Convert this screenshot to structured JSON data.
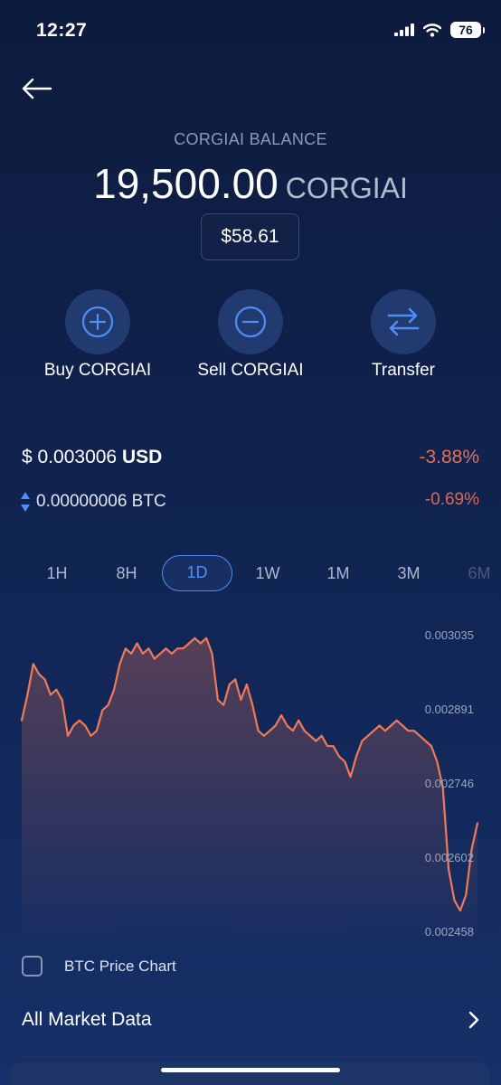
{
  "status_bar": {
    "time": "12:27",
    "battery": "76"
  },
  "header": {
    "balance_label": "CORGIAI BALANCE",
    "balance_amount": "19,500.00",
    "balance_unit": "CORGIAI",
    "usd_value": "$58.61"
  },
  "actions": [
    {
      "label": "Buy CORGIAI",
      "icon": "plus-circle-icon"
    },
    {
      "label": "Sell CORGIAI",
      "icon": "minus-circle-icon"
    },
    {
      "label": "Transfer",
      "icon": "swap-arrows-icon"
    }
  ],
  "price": {
    "usd_prefix": "$ ",
    "usd_value": "0.003006",
    "usd_suffix": " USD",
    "usd_change": "-3.88%",
    "btc_value": "0.00000006 BTC",
    "btc_change": "-0.69%"
  },
  "ranges": {
    "items": [
      "1H",
      "8H",
      "1D",
      "1W",
      "1M",
      "3M",
      "6M"
    ],
    "selected": "1D"
  },
  "chart_data": {
    "type": "area",
    "ylim": [
      0.002458,
      0.003035
    ],
    "y_ticks": [
      "0.003035",
      "0.002891",
      "0.002746",
      "0.002602",
      "0.002458"
    ],
    "x": [
      0,
      1,
      2,
      3,
      4,
      5,
      6,
      7,
      8,
      9,
      10,
      11,
      12,
      13,
      14,
      15,
      16,
      17,
      18,
      19,
      20,
      21,
      22,
      23,
      24,
      25,
      26,
      27,
      28,
      29,
      30,
      31,
      32,
      33,
      34,
      35,
      36,
      37,
      38,
      39,
      40,
      41,
      42,
      43,
      44,
      45,
      46,
      47,
      48,
      49,
      50,
      51,
      52,
      53,
      54,
      55,
      56,
      57,
      58,
      59,
      60,
      61,
      62,
      63,
      64,
      65,
      66,
      67,
      68,
      69,
      70,
      71,
      72,
      73,
      74,
      75,
      76,
      77,
      78,
      79,
      80,
      81,
      82,
      83,
      84,
      85,
      86,
      87,
      88,
      89,
      90,
      91,
      92,
      93,
      94,
      95,
      96,
      97,
      98,
      99,
      100
    ],
    "values": [
      0.00287,
      0.00292,
      0.00298,
      0.00296,
      0.00295,
      0.00292,
      0.00293,
      0.00291,
      0.00284,
      0.00286,
      0.00287,
      0.00286,
      0.00284,
      0.00285,
      0.00289,
      0.0029,
      0.00293,
      0.00298,
      0.00301,
      0.003,
      0.00302,
      0.003,
      0.00301,
      0.00299,
      0.003,
      0.00301,
      0.003,
      0.00301,
      0.00301,
      0.00302,
      0.00303,
      0.00302,
      0.00303,
      0.003,
      0.00291,
      0.0029,
      0.00294,
      0.00295,
      0.00291,
      0.00294,
      0.0029,
      0.00285,
      0.00284,
      0.00285,
      0.00286,
      0.00288,
      0.00286,
      0.00285,
      0.00287,
      0.00285,
      0.00284,
      0.00283,
      0.00284,
      0.00282,
      0.00282,
      0.0028,
      0.00279,
      0.00276,
      0.0028,
      0.00283,
      0.00284,
      0.00285,
      0.00286,
      0.00285,
      0.00286,
      0.00287,
      0.00286,
      0.00285,
      0.00285,
      0.00284,
      0.00283,
      0.00282,
      0.00279,
      0.00274,
      0.00258,
      0.00252,
      0.0025,
      0.00253,
      0.00262,
      0.00267
    ],
    "series": [
      {
        "color": "#f07a55"
      }
    ],
    "grid": false
  },
  "btc_chart_toggle": {
    "label": "BTC Price Chart",
    "checked": false
  },
  "market": {
    "label": "All Market Data"
  }
}
